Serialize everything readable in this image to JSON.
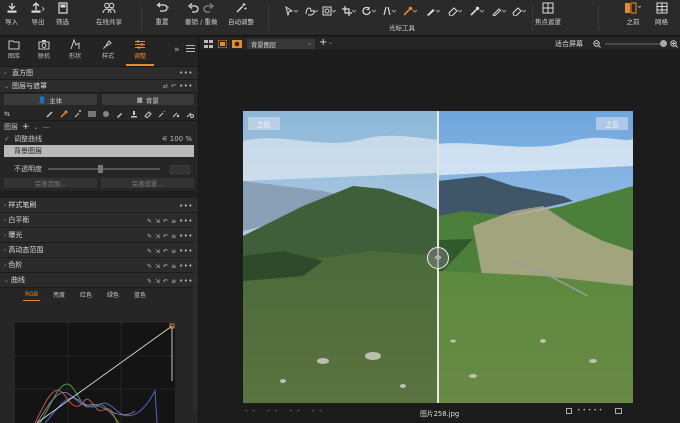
{
  "toolbar": {
    "import_label": "导入",
    "export_label": "导出",
    "filter_label": "筛选",
    "share_label": "在线共享",
    "reset_label": "重置",
    "undo_redo_label": "撤销 / 重做",
    "auto_adjust_label": "自动调整",
    "cursor_tools_label": "光标工具",
    "focus_mask_label": "焦点遮罩",
    "before_label": "之前",
    "grid_label": "网格",
    "accent_color": "#e58a2e"
  },
  "left_tabs": [
    {
      "label": "图库",
      "icon": "library-icon"
    },
    {
      "label": "联机",
      "icon": "tether-icon"
    },
    {
      "label": "形状",
      "icon": "shape-icon"
    },
    {
      "label": "样式",
      "icon": "style-icon"
    },
    {
      "label": "调整",
      "icon": "adjust-icon"
    }
  ],
  "sections": {
    "histogram": "直方图",
    "layers_masks": "图层与遮罩",
    "main_btn": "主体",
    "background_btn": "背景",
    "layers_label": "图层",
    "layer_items": [
      "调整曲线",
      "背景图层"
    ],
    "layer_opacity": "100 %",
    "opacity_label": "不透明度",
    "refine_edges": "完善范围...",
    "refine_mask": "完善遮罩...",
    "style_brush": "样式笔刷",
    "tools": [
      "白平衡",
      "曝光",
      "高动态范围",
      "色阶"
    ],
    "curve_title": "曲线",
    "curve_tabs": [
      "RGB",
      "亮度",
      "红色",
      "绿色",
      "蓝色"
    ]
  },
  "viewer": {
    "layer_select": "背景图层",
    "fit_screen": "适合屏幕",
    "before_tag": "之前",
    "after_tag": "之后",
    "filename": "图片258.jpg",
    "footer_dashes": "-- -- -- --"
  }
}
